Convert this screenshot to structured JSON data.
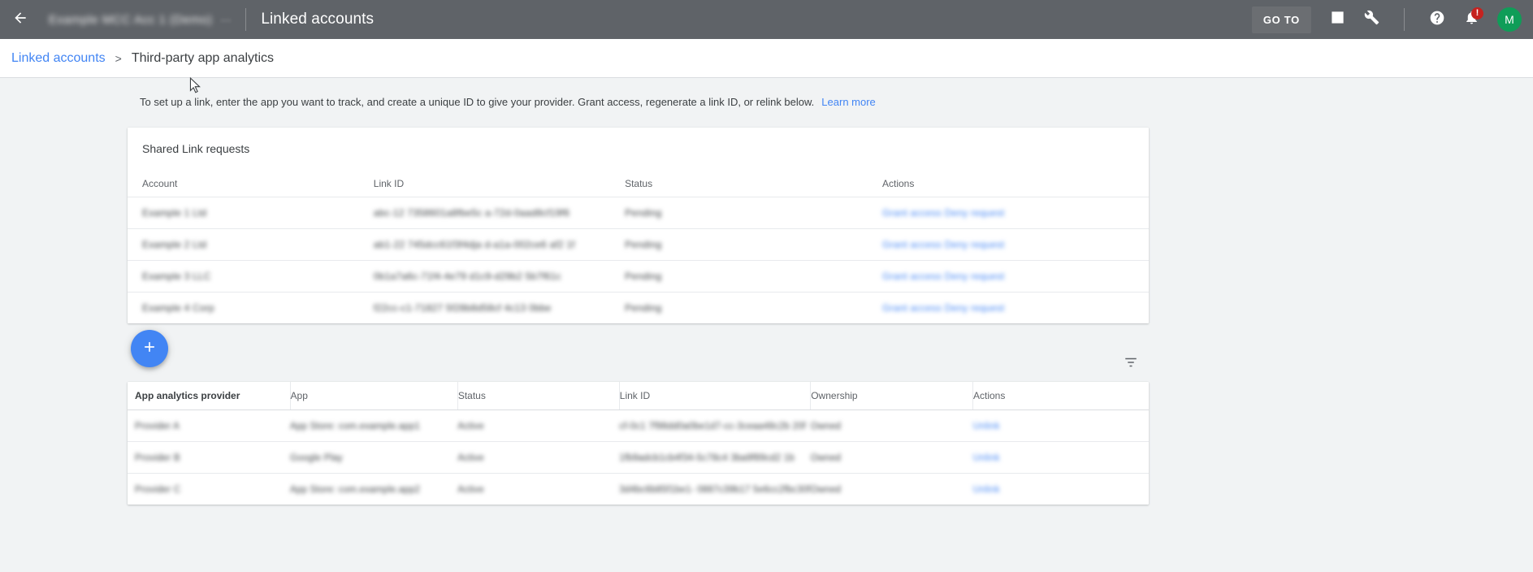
{
  "topbar": {
    "back_icon": "arrow-back-icon",
    "account_name_redacted": "Example MCC Acc 1 (Demo)",
    "account_id_redacted": "···",
    "page_title": "Linked accounts",
    "goto_label": "GO TO",
    "reports_icon": "bar-chart-icon",
    "tools_icon": "wrench-icon",
    "help_icon": "help-circle-icon",
    "notifications_icon": "bell-icon",
    "notification_badge": "!",
    "avatar_initial": "M",
    "avatar_color": "#0f9d58"
  },
  "breadcrumb": {
    "parent": "Linked accounts",
    "separator": ">",
    "current": "Third-party app analytics"
  },
  "description": {
    "text": "To set up a link, enter the app you want to track, and create a unique ID to give your provider. Grant access, regenerate a link ID, or relink below.",
    "learn_more": "Learn more"
  },
  "shared_link_requests": {
    "title": "Shared Link requests",
    "columns": [
      "Account",
      "Link ID",
      "Status",
      "Actions"
    ],
    "rows": [
      {
        "account": "Example 1 Ltd",
        "link_id": "abc-12 7358601a8fbe5c a-72d-0aad8cf19f6",
        "status": "Pending",
        "actions": "Grant access  Deny request"
      },
      {
        "account": "Example 2 Ltd",
        "link_id": "ab1-22 745dcc61f3f4dja d-a1a-002ce6 af2 1f",
        "status": "Pending",
        "actions": "Grant access  Deny request"
      },
      {
        "account": "Example 3 LLC",
        "link_id": "0b1a7a6c-71f4-4e79 d1c9-d29b2 5b7f61c",
        "status": "Pending",
        "actions": "Grant access  Deny request"
      },
      {
        "account": "Example 4 Corp",
        "link_id": "f22cc-c1-71827 5f28b8d58cf 4c13 0bbe",
        "status": "Pending",
        "actions": "Grant access  Deny request"
      }
    ]
  },
  "add_button": {
    "label": "+",
    "icon": "plus-icon"
  },
  "filter_button": {
    "icon": "filter-icon"
  },
  "app_analytics": {
    "columns": [
      "App analytics provider",
      "App",
      "Status",
      "Link ID",
      "Ownership",
      "Actions"
    ],
    "rows": [
      {
        "provider": "Provider A",
        "app": "App Store: com.example.app1",
        "status": "Active",
        "link_id": "cf-0c1 7f98dd0a0be1d7-cc-3ceaa48c2b 20f",
        "ownership": "Owned",
        "actions": "Unlink"
      },
      {
        "provider": "Provider B",
        "app": "Google Play",
        "status": "Active",
        "link_id": "1fb9adcb1cb4f34-5c78c4 3ba9f89cd2 1b",
        "ownership": "Owned",
        "actions": "Unlink"
      },
      {
        "provider": "Provider C",
        "app": "App Store: com.example.app2",
        "status": "Active",
        "link_id": "3d4bc6b85f1be1- 0887c39b17 5e6cc2fbc30f",
        "ownership": "Owned",
        "actions": "Unlink"
      }
    ]
  },
  "colors": {
    "topbar_bg": "#5f6368",
    "accent_blue": "#4285f4",
    "page_bg": "#f1f3f4",
    "card_bg": "#ffffff",
    "badge_red": "#c5221f"
  }
}
